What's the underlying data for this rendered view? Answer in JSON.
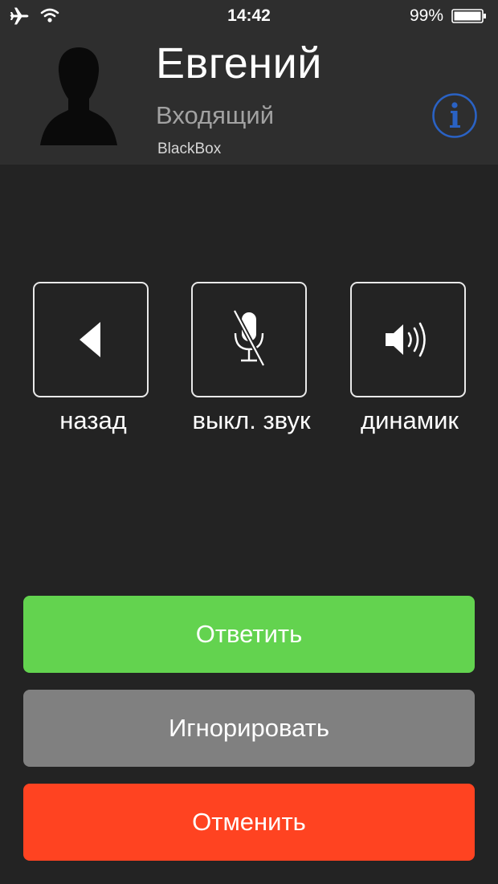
{
  "status_bar": {
    "time": "14:42",
    "battery_percent": "99%",
    "icons": [
      "airplane-icon",
      "wifi-icon",
      "battery-icon"
    ]
  },
  "caller": {
    "name": "Евгений",
    "status": "Входящий",
    "app": "BlackBox",
    "avatar_icon": "person-silhouette-icon",
    "info_icon": "info-icon"
  },
  "controls": [
    {
      "label": "назад",
      "icon": "back-triangle-icon"
    },
    {
      "label": "выкл. звук",
      "icon": "mic-muted-icon"
    },
    {
      "label": "динамик",
      "icon": "speaker-icon"
    }
  ],
  "actions": {
    "answer": "Ответить",
    "ignore": "Игнорировать",
    "cancel": "Отменить"
  },
  "colors": {
    "background": "#232323",
    "header": "#2e2e2e",
    "answer": "#63d34f",
    "ignore": "#808080",
    "cancel": "#ff4321",
    "info_accent": "#2a62c4"
  }
}
